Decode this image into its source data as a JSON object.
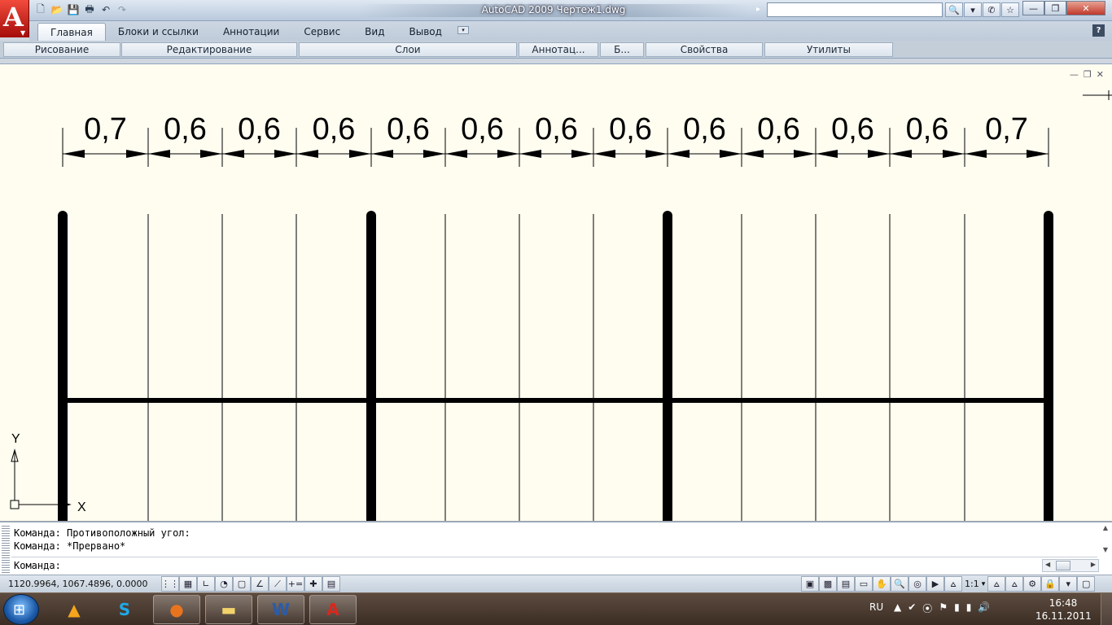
{
  "window": {
    "title": "AutoCAD 2009 Чертеж1.dwg",
    "app_logo_letter": "A",
    "logo_menu_arrow": "▼",
    "search_arrow": "▸",
    "search": {
      "value": "",
      "placeholder": ""
    },
    "title_tools": [
      {
        "name": "search-icon",
        "glyph": "🔍"
      },
      {
        "name": "chevron-down-icon",
        "glyph": "▾"
      },
      {
        "name": "communication-center-icon",
        "glyph": "✆"
      },
      {
        "name": "favorites-star-icon",
        "glyph": "☆"
      }
    ],
    "controls": {
      "minimize": "—",
      "restore": "❐",
      "close": "✕"
    }
  },
  "quick_access": [
    {
      "name": "new-file-icon",
      "glyph": "🗋",
      "enabled": true
    },
    {
      "name": "open-folder-icon",
      "glyph": "📂",
      "enabled": true
    },
    {
      "name": "save-icon",
      "glyph": "💾",
      "enabled": true
    },
    {
      "name": "print-icon",
      "glyph": "🖶",
      "enabled": true
    },
    {
      "name": "undo-icon",
      "glyph": "↶",
      "enabled": true
    },
    {
      "name": "redo-icon",
      "glyph": "↷",
      "enabled": false
    }
  ],
  "ribbon": {
    "tabs": [
      "Главная",
      "Блоки и ссылки",
      "Аннотации",
      "Сервис",
      "Вид",
      "Вывод"
    ],
    "active_tab": 0,
    "more_glyph": "▾",
    "help_glyph": "?",
    "panels": [
      "Рисование",
      "Редактирование",
      "Слои",
      "Аннотац...",
      "Б...",
      "Свойства",
      "Утилиты"
    ]
  },
  "drawing_controls": {
    "minimize": "—",
    "restore": "❐",
    "close": "✕"
  },
  "drawing": {
    "dimensions": [
      "0,7",
      "0,6",
      "0,6",
      "0,6",
      "0,6",
      "0,6",
      "0,6",
      "0,6",
      "0,6",
      "0,6",
      "0,6",
      "0,6",
      "0,7"
    ],
    "ucs_x": "X",
    "ucs_y": "Y"
  },
  "command_line": {
    "history": [
      "Команда: Противоположный угол:",
      "Команда: *Прервано*"
    ],
    "prompt": "Команда:",
    "input_value": ""
  },
  "status_bar": {
    "coordinates": "1120.9964, 1067.4896, 0.0000",
    "snap_tools": [
      {
        "name": "snap-mode-icon",
        "glyph": "⋮⋮"
      },
      {
        "name": "grid-display-icon",
        "glyph": "▦"
      },
      {
        "name": "ortho-mode-icon",
        "glyph": "∟"
      },
      {
        "name": "polar-tracking-icon",
        "glyph": "◔"
      },
      {
        "name": "object-snap-icon",
        "glyph": "▢"
      },
      {
        "name": "object-snap-tracking-icon",
        "glyph": "∠"
      },
      {
        "name": "dynamic-ucs-icon",
        "glyph": "⟋"
      },
      {
        "name": "dynamic-input-icon",
        "glyph": "+="
      },
      {
        "name": "lineweight-icon",
        "glyph": "✚"
      },
      {
        "name": "quick-properties-icon",
        "glyph": "▤"
      }
    ],
    "view_tools": [
      {
        "name": "model-space-icon",
        "glyph": "▣"
      },
      {
        "name": "layout1-icon",
        "glyph": "▩"
      },
      {
        "name": "layout2-icon",
        "glyph": "▤"
      },
      {
        "name": "quick-view-icon",
        "glyph": "▭"
      },
      {
        "name": "pan-icon",
        "glyph": "✋"
      },
      {
        "name": "zoom-icon",
        "glyph": "🔍"
      },
      {
        "name": "steering-wheel-icon",
        "glyph": "◎"
      },
      {
        "name": "showmotion-icon",
        "glyph": "▶"
      }
    ],
    "annotation_scale_icon": "⩟",
    "annotation_scale": "1:1",
    "scale_arrow": "▾",
    "extra_tools": [
      {
        "name": "annotation-visibility-icon",
        "glyph": "⩟"
      },
      {
        "name": "annotation-autoscale-icon",
        "glyph": "⩟"
      },
      {
        "name": "workspace-switching-icon",
        "glyph": "⚙"
      },
      {
        "name": "lock-icon",
        "glyph": "🔒"
      },
      {
        "name": "status-menu-arrow-icon",
        "glyph": "▾"
      },
      {
        "name": "clean-screen-icon",
        "glyph": "▢"
      }
    ]
  },
  "taskbar": {
    "start_glyph": "⊞",
    "apps": [
      {
        "name": "taskbar-aimp",
        "glyph": "▲",
        "color": "#f5a51c",
        "framed": false
      },
      {
        "name": "taskbar-skype",
        "glyph": "S",
        "color": "#1fa9e6",
        "framed": false
      },
      {
        "name": "taskbar-firefox",
        "glyph": "●",
        "color": "#e8741e",
        "framed": true
      },
      {
        "name": "taskbar-explorer",
        "glyph": "▬",
        "color": "#f2d36b",
        "framed": true
      },
      {
        "name": "taskbar-word",
        "glyph": "W",
        "color": "#2a5caa",
        "framed": true
      },
      {
        "name": "taskbar-autocad",
        "glyph": "A",
        "color": "#d8281e",
        "framed": true
      }
    ],
    "language": "RU",
    "tray": [
      "▲",
      "✔",
      "⦿",
      "⚑",
      "▮",
      "▮",
      "🔊"
    ],
    "time": "16:48",
    "date": "16.11.2011"
  },
  "colors": {
    "drawing_background": "#fffdf0",
    "titlebar": "#c4d3e4",
    "taskbar": "#4a3a30"
  }
}
